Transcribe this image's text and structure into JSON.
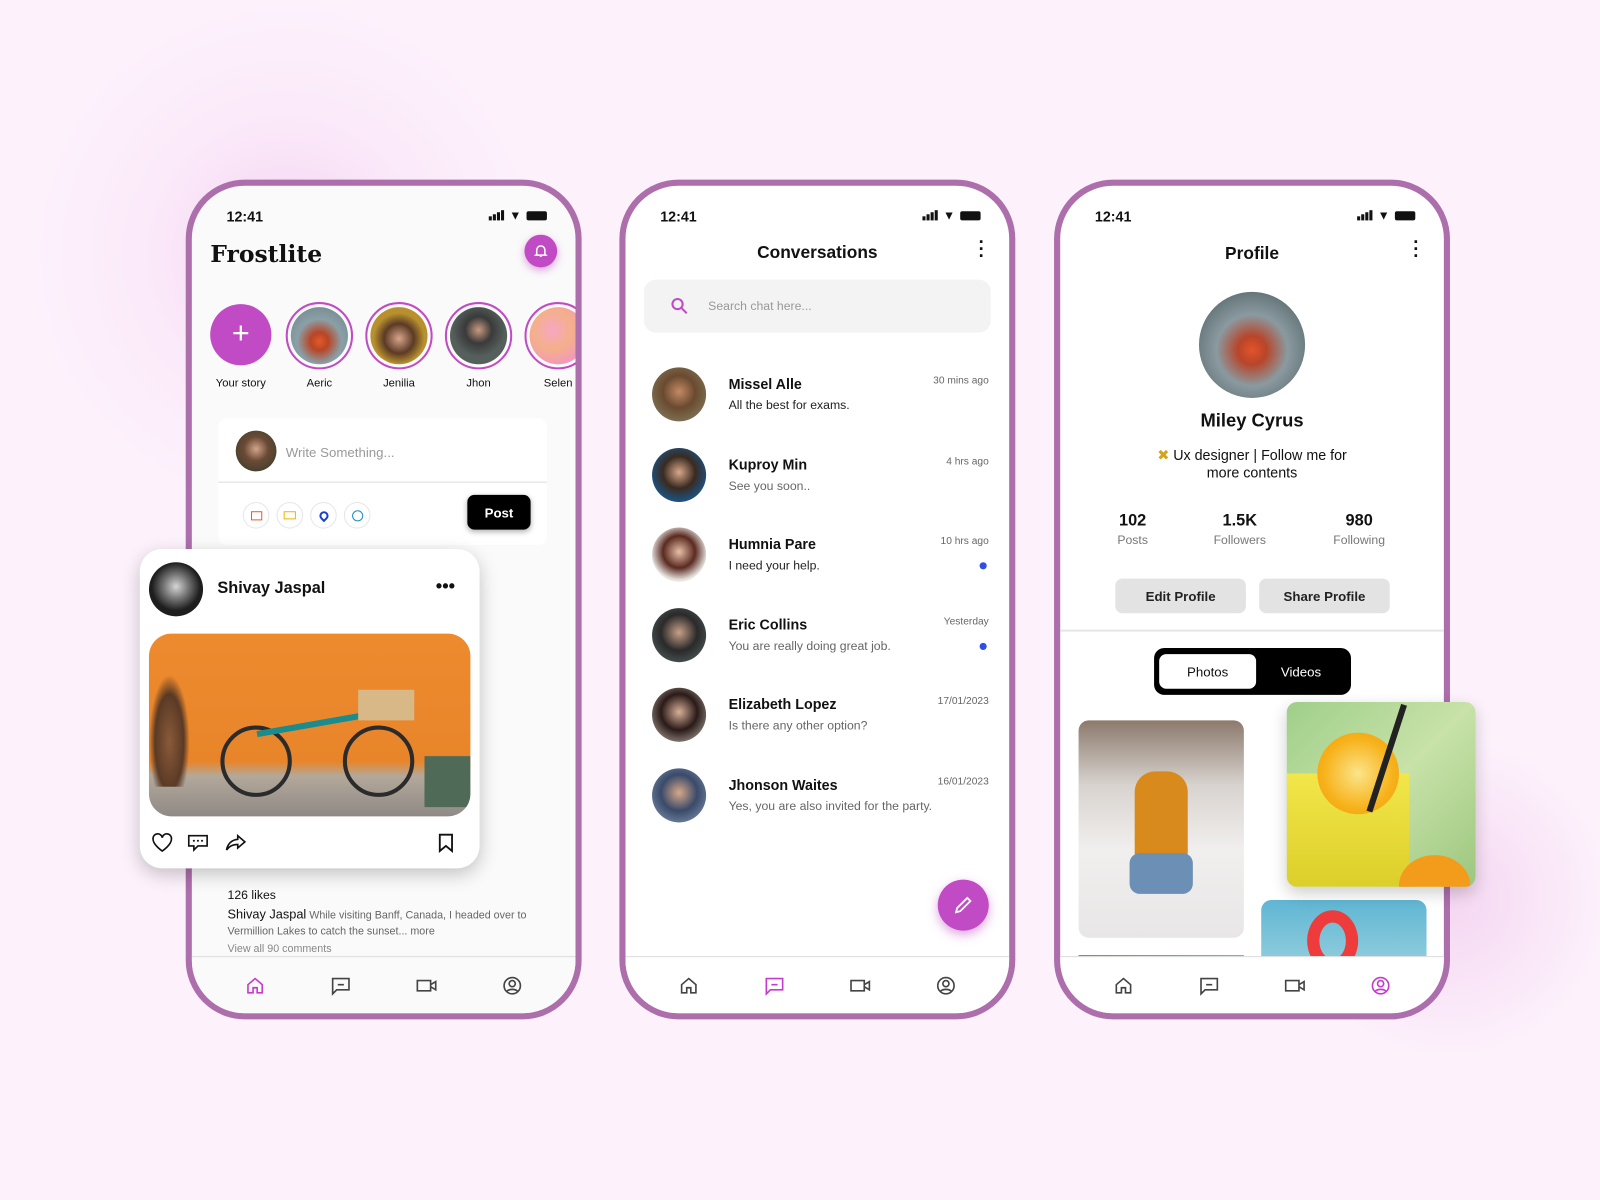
{
  "status_time": "12:41",
  "colors": {
    "accent": "#c04bc4",
    "frame": "#ad6eac",
    "unread_dot": "#2f4ee6"
  },
  "feed": {
    "app_title": "Frostlite",
    "notification_icon": "bell-icon",
    "stories": [
      {
        "label": "Your story"
      },
      {
        "label": "Aeric"
      },
      {
        "label": "Jenilia"
      },
      {
        "label": "Jhon"
      },
      {
        "label": "Selen"
      }
    ],
    "composer": {
      "placeholder": "Write Something...",
      "post_label": "Post",
      "icons": [
        "image-icon",
        "video-icon",
        "location-icon",
        "emoji-icon"
      ]
    },
    "post": {
      "author": "Shivay Jaspal",
      "likes": "126 likes",
      "caption_author": "Shivay Jaspal",
      "caption": "While visiting Banff, Canada, I headed over to Vermillion Lakes to catch the sunset... more",
      "comments": "View all 90 comments"
    },
    "nav": [
      "home-icon",
      "chat-icon",
      "video-icon",
      "profile-icon"
    ],
    "active_nav": "home"
  },
  "conversations": {
    "title": "Conversations",
    "search_placeholder": "Search chat here...",
    "items": [
      {
        "name": "Missel Alle",
        "message": "All the best for exams.",
        "time": "30 mins ago",
        "unread": false
      },
      {
        "name": "Kuproy Min",
        "message": "See you soon..",
        "time": "4 hrs ago",
        "unread": false
      },
      {
        "name": "Humnia Pare",
        "message": "I need your help.",
        "time": "10 hrs ago",
        "unread": true
      },
      {
        "name": "Eric Collins",
        "message": "You are really doing great job.",
        "time": "Yesterday",
        "unread": true
      },
      {
        "name": "Elizabeth Lopez",
        "message": "Is there any other option?",
        "time": "17/01/2023",
        "unread": false
      },
      {
        "name": "Jhonson Waites",
        "message": "Yes, you are also invited for the party.",
        "time": "16/01/2023",
        "unread": false
      }
    ],
    "active_nav": "chat"
  },
  "profile": {
    "title": "Profile",
    "name": "Miley Cyrus",
    "bio_line1": "Ux designer | Follow me for",
    "bio_line2": "more contents",
    "stats": [
      {
        "value": "102",
        "label": "Posts"
      },
      {
        "value": "1.5K",
        "label": "Followers"
      },
      {
        "value": "980",
        "label": "Following"
      }
    ],
    "edit_label": "Edit Profile",
    "share_label": "Share Profile",
    "tabs": [
      {
        "label": "Photos",
        "active": true
      },
      {
        "label": "Videos",
        "active": false
      }
    ],
    "active_nav": "profile"
  }
}
